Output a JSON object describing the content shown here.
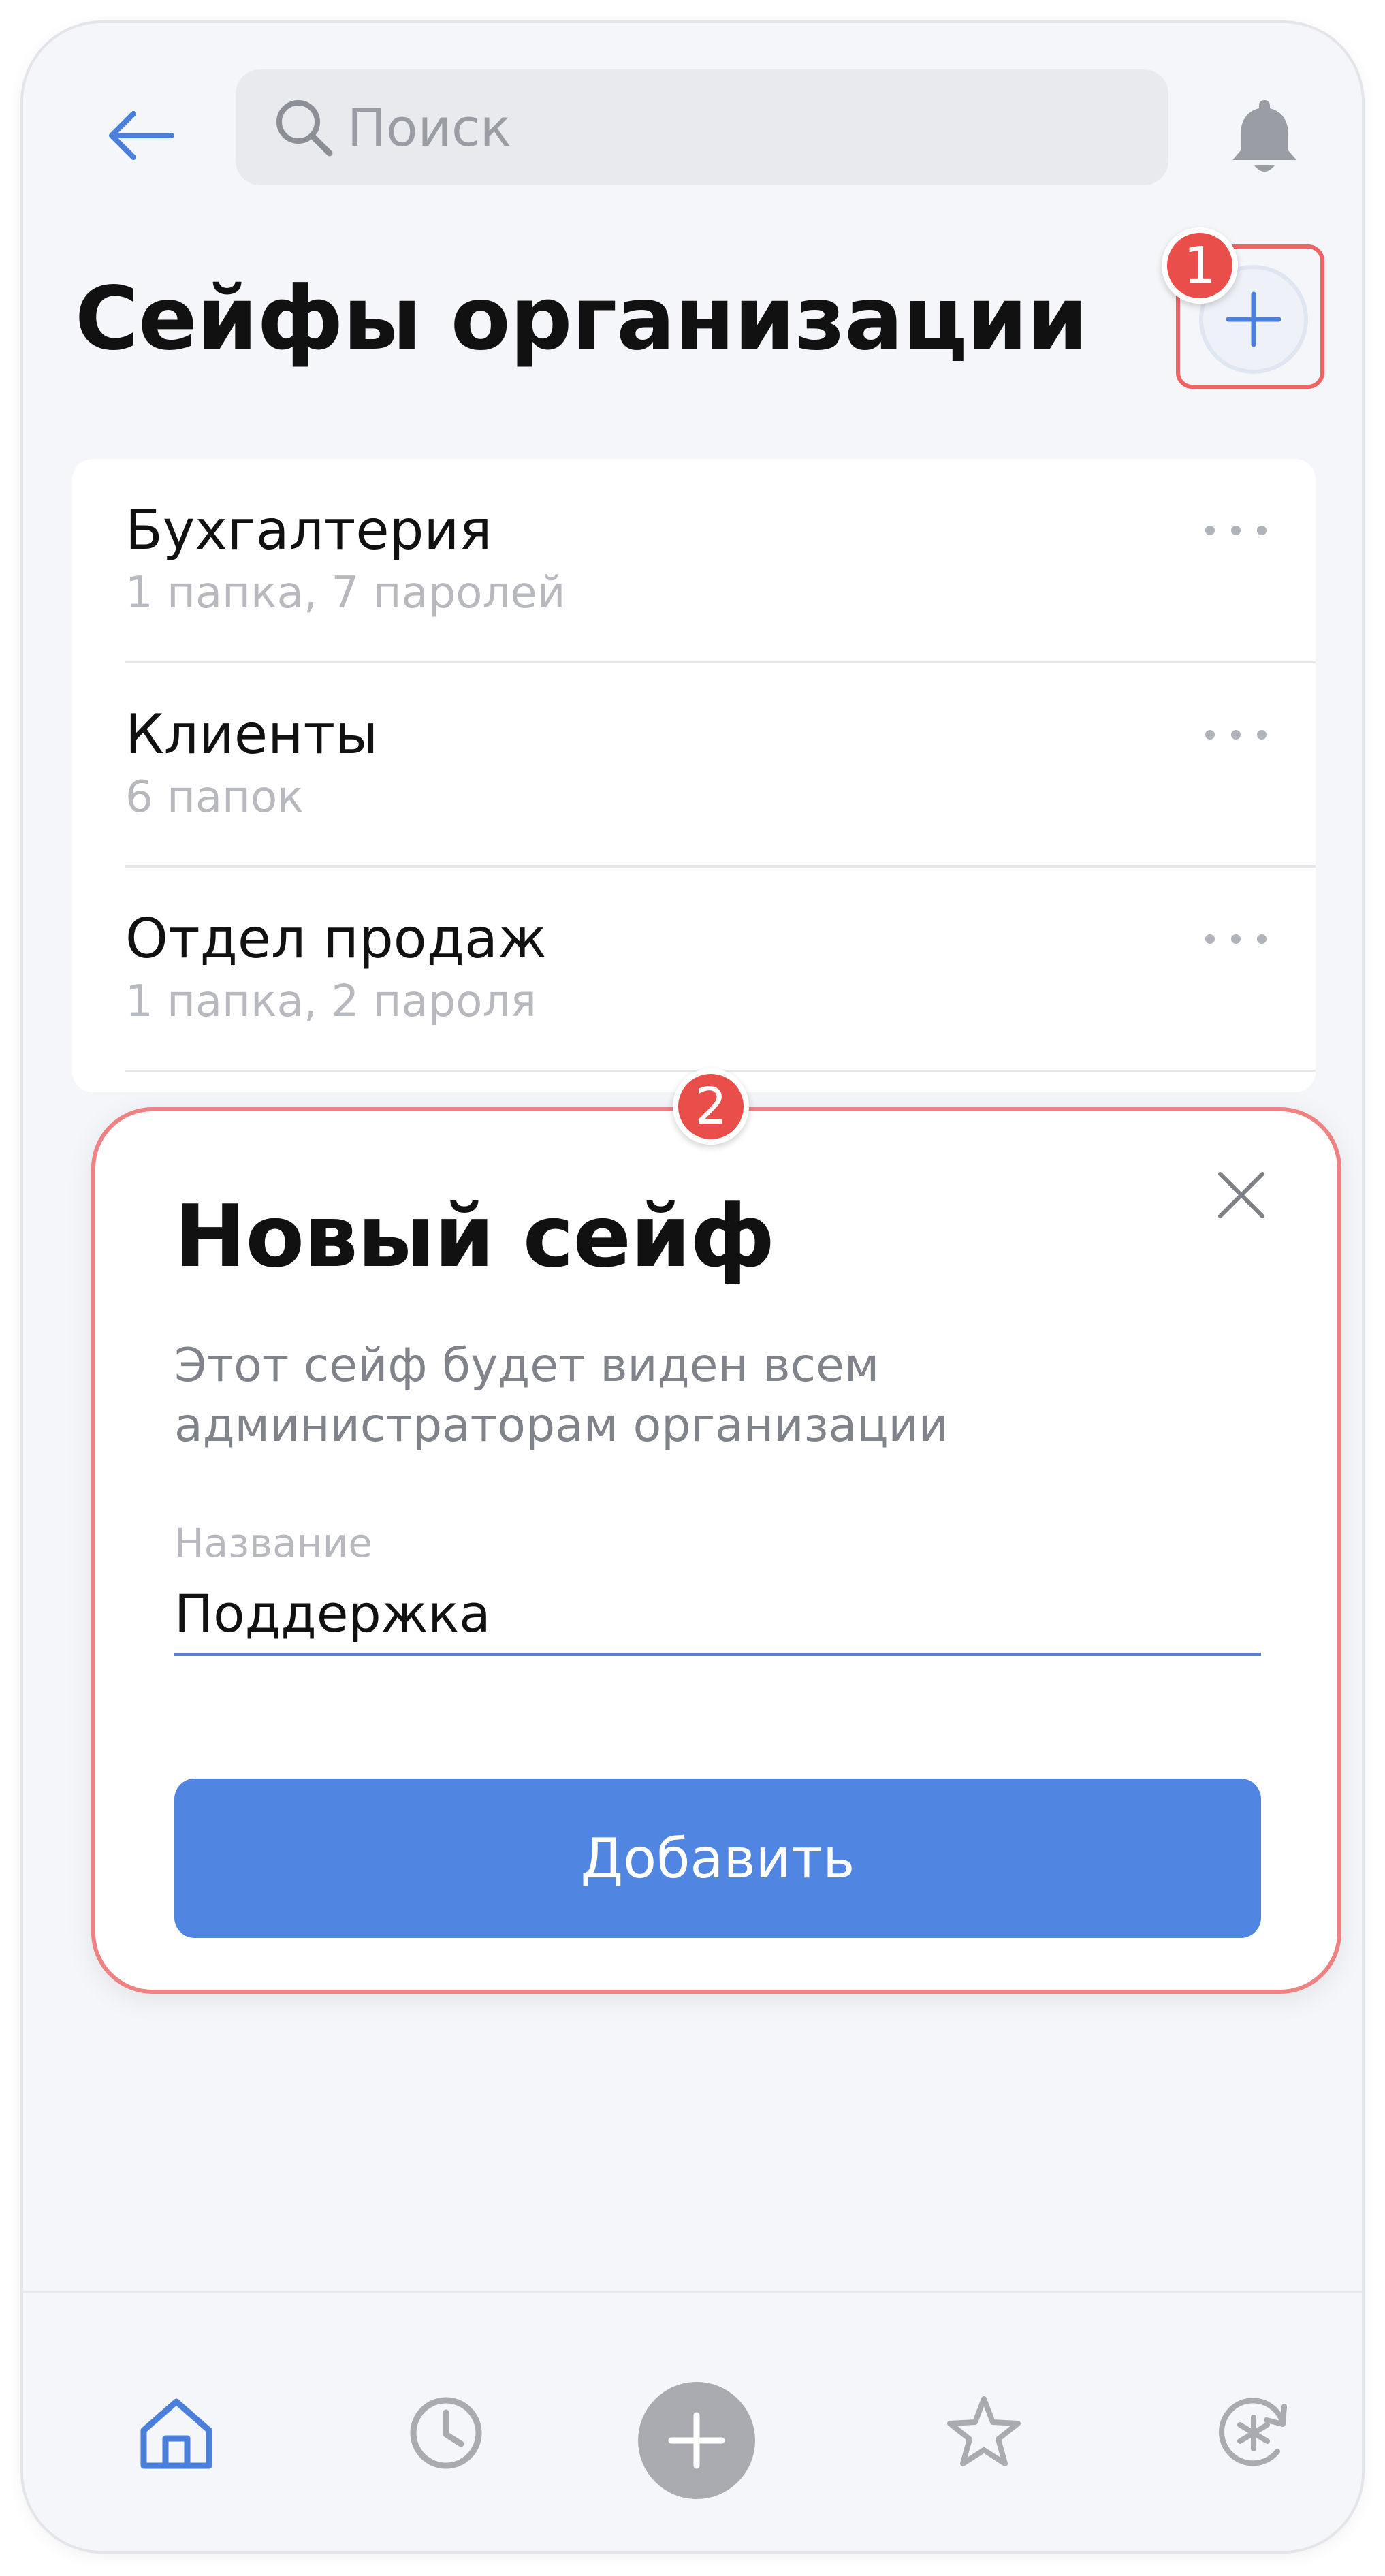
{
  "header": {
    "search_placeholder": "Поиск"
  },
  "page": {
    "title": "Сейфы организации"
  },
  "badges": {
    "first": "1",
    "second": "2"
  },
  "vaults": [
    {
      "name": "Бухгалтерия",
      "meta": "1 папка, 7 паролей"
    },
    {
      "name": "Клиенты",
      "meta": "6 папок"
    },
    {
      "name": "Отдел продаж",
      "meta": "1 папка, 2 пароля"
    }
  ],
  "modal": {
    "title": "Новый сейф",
    "description": "Этот сейф будет виден всем администраторам организации",
    "field_label": "Название",
    "field_value": "Поддержка",
    "submit_label": "Добавить"
  },
  "colors": {
    "accent": "#5185e2",
    "highlight": "#ea4e4b",
    "icon_inactive": "#a9abb0"
  },
  "icons": [
    "back-arrow-icon",
    "search-icon",
    "bell-icon",
    "plus-icon",
    "more-dots-icon",
    "close-icon",
    "home-icon",
    "clock-icon",
    "star-icon",
    "password-generator-icon"
  ]
}
